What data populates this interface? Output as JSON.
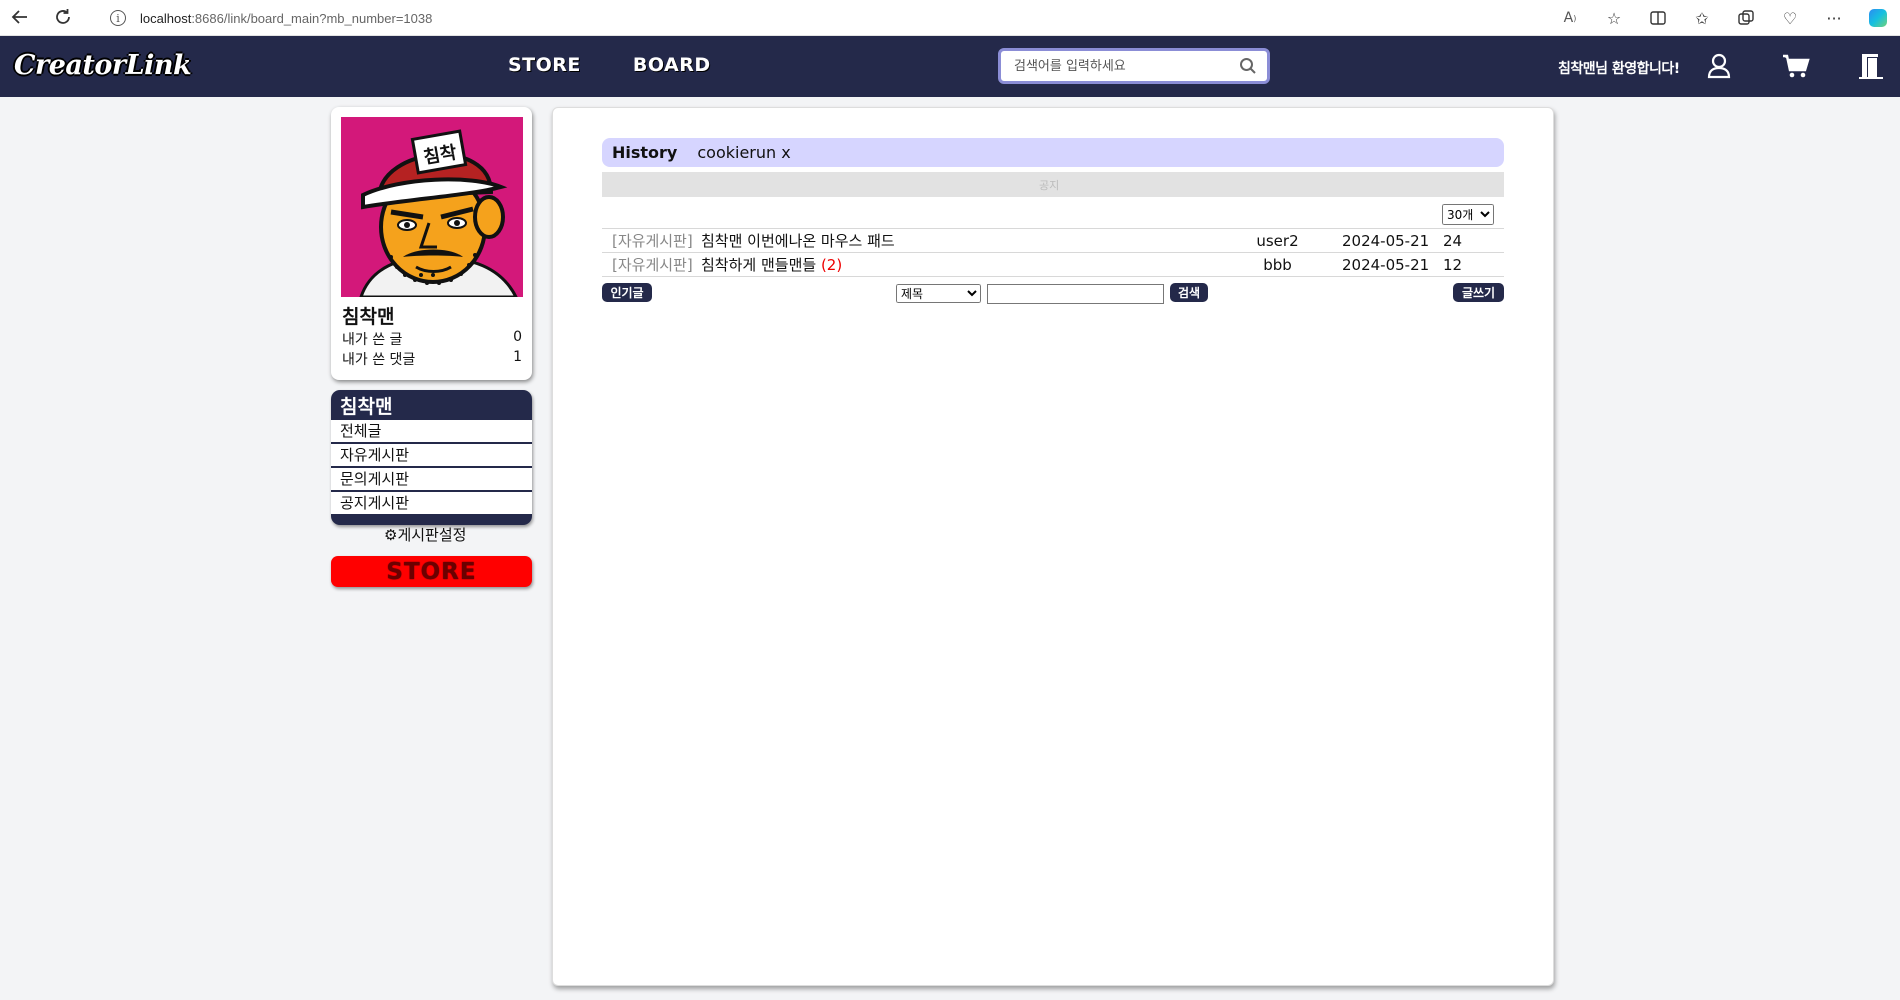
{
  "browser": {
    "url_host": "localhost",
    "url_rest": ":8686/link/board_main?mb_number=1038"
  },
  "header": {
    "logo": "CreatorLink",
    "nav": [
      "STORE",
      "BOARD"
    ],
    "search_placeholder": "검색어를 입력하세요",
    "welcome": "침착맨님 환영합니다!"
  },
  "profile": {
    "name": "침착맨",
    "stats": [
      {
        "label": "내가 쓴 글",
        "value": "0"
      },
      {
        "label": "내가 쓴 댓글",
        "value": "1"
      }
    ],
    "avatar_cap_text": "침착"
  },
  "category": {
    "title": "침착맨",
    "items": [
      "전체글",
      "자유게시판",
      "문의게시판",
      "공지게시판"
    ],
    "setting_label": "⚙게시판설정",
    "store_banner": "STORE"
  },
  "board": {
    "history_label": "History",
    "history_tag": "cookierun x",
    "notice_text": "공지",
    "per_page": "30개",
    "posts": [
      {
        "category": "[자유게시판]",
        "title": "침착맨 이번에나온 마우스 패드",
        "replies": "",
        "writer": "user2",
        "date": "2024-05-21",
        "views": "24"
      },
      {
        "category": "[자유게시판]",
        "title": "침착하게 맨들맨들 ",
        "replies": "(2)",
        "writer": "bbb",
        "date": "2024-05-21",
        "views": "12"
      }
    ],
    "popular_label": "인기글",
    "search_type": "제목",
    "search_label": "검색",
    "write_label": "글쓰기"
  },
  "colors": {
    "header_bg": "#24294a",
    "history_bg": "#d6d5ff",
    "store_red": "#ff0000",
    "reply_red": "#ee0000"
  }
}
